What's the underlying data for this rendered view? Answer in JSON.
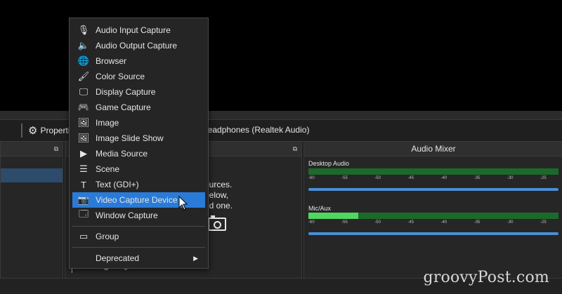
{
  "toolbar": {
    "properties_label": "Properties",
    "device_label": "Headphones (Realtek Audio)"
  },
  "sources": {
    "empty_text_lines": [
      "ources.",
      "below,",
      "dd one."
    ]
  },
  "mixer": {
    "title": "Audio Mixer",
    "channels": [
      {
        "name": "Desktop Audio",
        "ticks": [
          "-60",
          "-55",
          "-50",
          "-45",
          "-40",
          "-35",
          "-30",
          "-25"
        ],
        "level_fraction": 0.0
      },
      {
        "name": "Mic/Aux",
        "ticks": [
          "-60",
          "-55",
          "-50",
          "-45",
          "-40",
          "-35",
          "-30",
          "-25"
        ],
        "level_fraction": 0.2
      }
    ]
  },
  "menu": {
    "items": [
      {
        "label": "Audio Input Capture",
        "icon": "microphone-icon"
      },
      {
        "label": "Audio Output Capture",
        "icon": "speaker-icon"
      },
      {
        "label": "Browser",
        "icon": "globe-icon"
      },
      {
        "label": "Color Source",
        "icon": "brush-icon"
      },
      {
        "label": "Display Capture",
        "icon": "monitor-icon"
      },
      {
        "label": "Game Capture",
        "icon": "gamepad-icon"
      },
      {
        "label": "Image",
        "icon": "image-icon"
      },
      {
        "label": "Image Slide Show",
        "icon": "slideshow-icon"
      },
      {
        "label": "Media Source",
        "icon": "play-icon"
      },
      {
        "label": "Scene",
        "icon": "list-icon"
      },
      {
        "label": "Text (GDI+)",
        "icon": "text-icon"
      },
      {
        "label": "Video Capture Device",
        "icon": "camera-icon",
        "selected": true
      },
      {
        "label": "Window Capture",
        "icon": "window-icon"
      }
    ],
    "group_label": "Group",
    "deprecated_label": "Deprecated"
  },
  "watermark": "groovyPost.com"
}
